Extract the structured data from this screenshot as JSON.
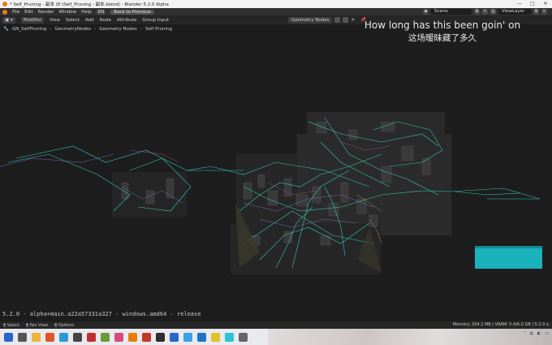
{
  "window": {
    "title": "* Self_Pruning - 副本 (E:\\Self_Pruning - 副本.blend) - Blender 5.2.0 Alpha",
    "controls": [
      "—",
      "□",
      "✕"
    ]
  },
  "menubar": {
    "items": [
      "File",
      "Edit",
      "Render",
      "Window",
      "Help"
    ],
    "lang": "EN",
    "back": "Back to Previous",
    "scene": "Scene",
    "view_layer": "ViewLayer"
  },
  "editor_header": {
    "editor_type": "Modifier",
    "menus": [
      "View",
      "Select",
      "Add",
      "Node",
      "Attribute",
      "Group Input"
    ],
    "node_group": "Geometry Nodes"
  },
  "breadcrumb": [
    "GN_SelfPruning",
    "GeometryNodes",
    "Geometry Nodes",
    "Self Pruning"
  ],
  "subtitles": {
    "en": "How long has this been goin' on",
    "cn": "这场暧昧藏了多久"
  },
  "version": "5.2.0 - alpha+main.a22a57331a327 - windows.amd64 - release",
  "statusbar": {
    "items": [
      "Select",
      "Pan View",
      "Options"
    ],
    "memory": "Memory: 204.2 MB | VRAM: 5.4/6.0 GB | 5.2.0 a"
  },
  "taskbar": {
    "icons": [
      "start",
      "search",
      "files",
      "browser",
      "blender",
      "app5",
      "app6",
      "app7",
      "app8",
      "app9",
      "app10",
      "app11",
      "app12",
      "app13",
      "app14",
      "app15",
      "app16",
      "app17"
    ],
    "colors": [
      "#2a66c9",
      "#555555",
      "#f0b43c",
      "#e0542b",
      "#2a9bd6",
      "#444444",
      "#bd3030",
      "#6a9d3a",
      "#d84a7a",
      "#e87d0d",
      "#c0392b",
      "#2d2d2d",
      "#2a66c9",
      "#3aa0e8",
      "#1f74c9",
      "#e0c32b",
      "#2ac4d6",
      "#666666"
    ]
  },
  "colors": {
    "accent": "#e87d0d",
    "wire": "#39d6c2",
    "panel": "#2b2b2b",
    "cyan_node": "#19b2bd"
  }
}
